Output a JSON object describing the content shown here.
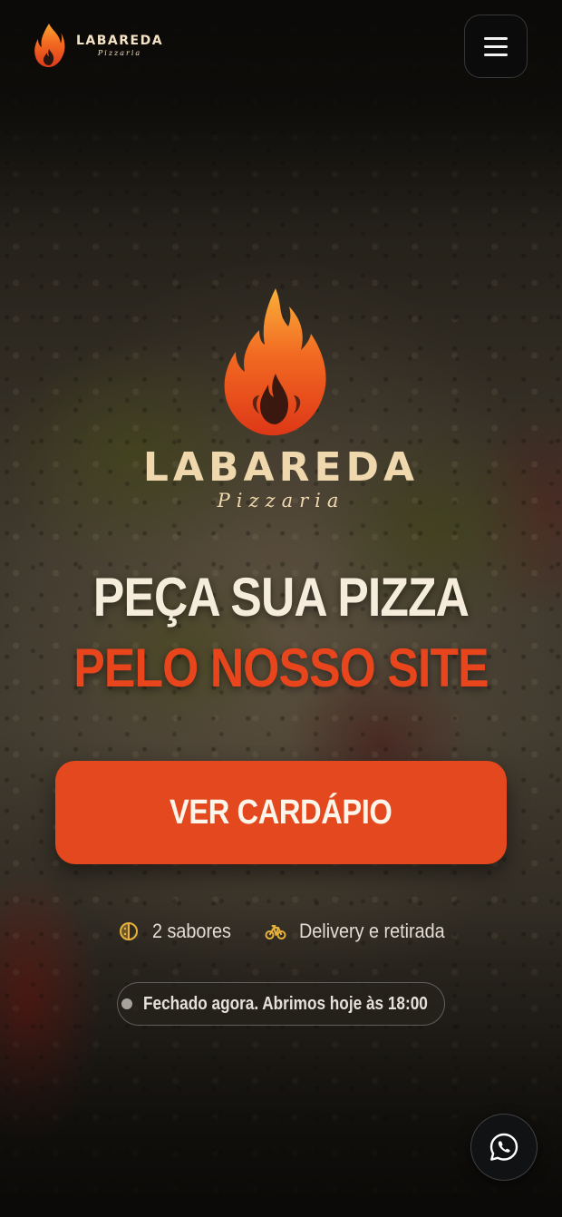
{
  "brand": {
    "name": "LABAREDA",
    "subtitle": "Pizzaria"
  },
  "header": {
    "logo_icon": "flame-icon",
    "menu_icon": "hamburger-menu-icon"
  },
  "hero": {
    "headline_line1": "PEÇA SUA PIZZA",
    "headline_line2": "PELO NOSSO SITE",
    "cta_label": "VER CARDÁPIO"
  },
  "features": [
    {
      "icon": "half-pizza-icon",
      "label": "2 sabores"
    },
    {
      "icon": "bicycle-icon",
      "label": "Delivery e retirada"
    }
  ],
  "status": {
    "text": "Fechado agora. Abrimos hoje às 18:00",
    "dot_color": "#a8a49d"
  },
  "floating": {
    "whatsapp_icon": "whatsapp-icon"
  },
  "colors": {
    "accent": "#e3481e",
    "headline_accent": "#e8451c",
    "brand_cream": "#f0d8ae",
    "feature_icon": "#e7b23a"
  }
}
